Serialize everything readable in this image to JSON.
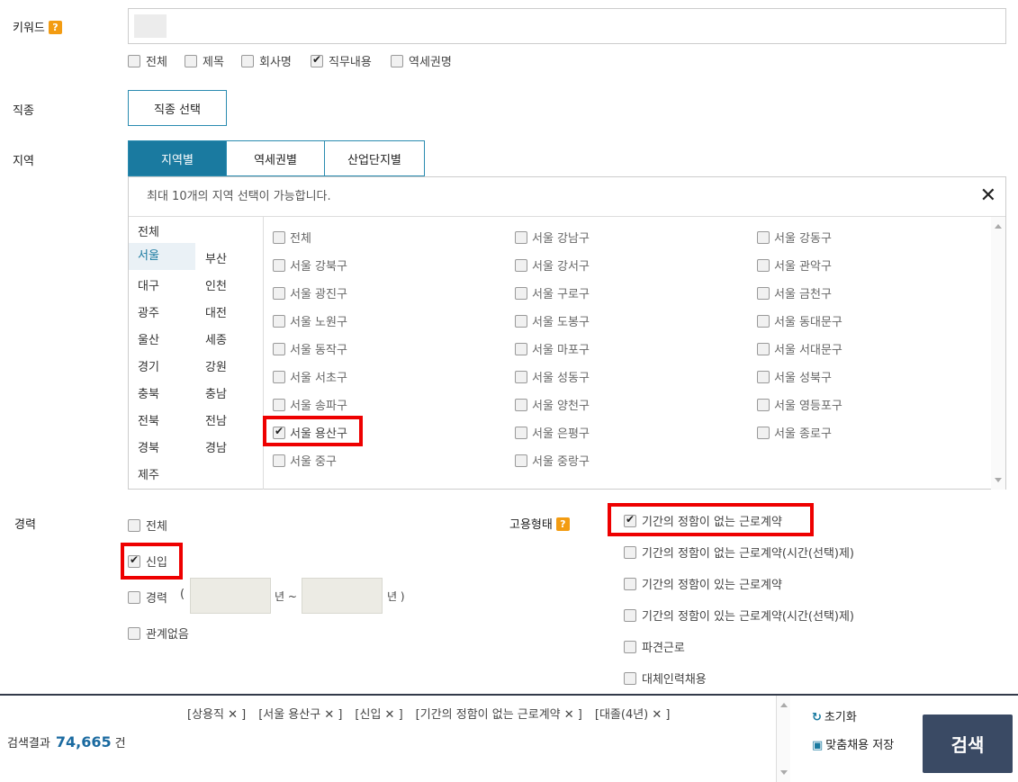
{
  "keyword": {
    "label": "키워드",
    "help": "?",
    "options": [
      {
        "label": "전체",
        "checked": false
      },
      {
        "label": "제목",
        "checked": false
      },
      {
        "label": "회사명",
        "checked": false
      },
      {
        "label": "직무내용",
        "checked": true
      },
      {
        "label": "역세권명",
        "checked": false
      }
    ]
  },
  "job_type": {
    "label": "직종",
    "button": "직종 선택"
  },
  "region": {
    "label": "지역",
    "tabs": [
      "지역별",
      "역세권별",
      "산업단지별"
    ],
    "notice": "최대 10개의 지역 선택이 가능합니다.",
    "close": "✕",
    "provinces": [
      "전체",
      "서울",
      "부산",
      "대구",
      "인천",
      "광주",
      "대전",
      "울산",
      "세종",
      "경기",
      "강원",
      "충북",
      "충남",
      "전북",
      "전남",
      "경북",
      "경남",
      "제주"
    ],
    "selected_province": "서울",
    "districts": [
      {
        "label": "전체",
        "checked": false
      },
      {
        "label": "서울 강남구",
        "checked": false
      },
      {
        "label": "서울 강동구",
        "checked": false
      },
      {
        "label": "서울 강북구",
        "checked": false
      },
      {
        "label": "서울 강서구",
        "checked": false
      },
      {
        "label": "서울 관악구",
        "checked": false
      },
      {
        "label": "서울 광진구",
        "checked": false
      },
      {
        "label": "서울 구로구",
        "checked": false
      },
      {
        "label": "서울 금천구",
        "checked": false
      },
      {
        "label": "서울 노원구",
        "checked": false
      },
      {
        "label": "서울 도봉구",
        "checked": false
      },
      {
        "label": "서울 동대문구",
        "checked": false
      },
      {
        "label": "서울 동작구",
        "checked": false
      },
      {
        "label": "서울 마포구",
        "checked": false
      },
      {
        "label": "서울 서대문구",
        "checked": false
      },
      {
        "label": "서울 서초구",
        "checked": false
      },
      {
        "label": "서울 성동구",
        "checked": false
      },
      {
        "label": "서울 성북구",
        "checked": false
      },
      {
        "label": "서울 송파구",
        "checked": false
      },
      {
        "label": "서울 양천구",
        "checked": false
      },
      {
        "label": "서울 영등포구",
        "checked": false
      },
      {
        "label": "서울 용산구",
        "checked": true
      },
      {
        "label": "서울 은평구",
        "checked": false
      },
      {
        "label": "서울 종로구",
        "checked": false
      },
      {
        "label": "서울 중구",
        "checked": false
      },
      {
        "label": "서울 중랑구",
        "checked": false
      }
    ]
  },
  "career": {
    "label": "경력",
    "options": [
      {
        "label": "전체",
        "checked": false
      },
      {
        "label": "신입",
        "checked": true
      },
      {
        "label": "경력",
        "checked": false
      },
      {
        "label": "관계없음",
        "checked": false
      }
    ],
    "range_open": "(",
    "range_year1": "년 ~",
    "range_year2": "년 )"
  },
  "employment": {
    "label": "고용형태",
    "help": "?",
    "options": [
      {
        "label": "기간의 정함이 없는 근로계약",
        "checked": true
      },
      {
        "label": "기간의 정함이 없는 근로계약(시간(선택)제)",
        "checked": false
      },
      {
        "label": "기간의 정함이 있는 근로계약",
        "checked": false
      },
      {
        "label": "기간의 정함이 있는 근로계약(시간(선택)제)",
        "checked": false
      },
      {
        "label": "파견근로",
        "checked": false
      },
      {
        "label": "대체인력채용",
        "checked": false
      }
    ]
  },
  "bottom": {
    "tags": [
      "[상용직 ✕ ]",
      "[서울 용산구 ✕ ]",
      "[신입 ✕ ]",
      "[기간의 정함이 없는 근로계약 ✕ ]",
      "[대졸(4년) ✕ ]"
    ],
    "result_label": "검색결과",
    "result_count": "74,665",
    "result_unit": "건",
    "reset": "초기화",
    "save": "맞춤채용 저장",
    "search": "검색"
  }
}
